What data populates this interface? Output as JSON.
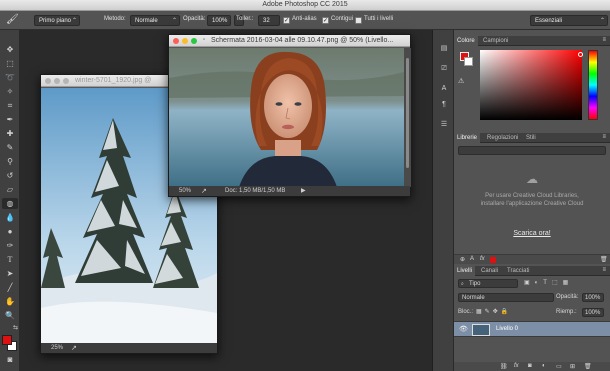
{
  "app": {
    "title": "Adobe Photoshop CC 2015"
  },
  "options_bar": {
    "tool_preset_icon": "brush-icon",
    "preset_dropdown": "Primo piano",
    "method_label": "Metodo:",
    "method_value": "Normale",
    "opacity_label": "Opacità:",
    "opacity_value": "100%",
    "tolerance_label": "Toller.:",
    "tolerance_value": "32",
    "antialias_label": "Anti-alias",
    "contiguous_label": "Contigui",
    "all_layers_label": "Tutti i livelli",
    "workspace_value": "Essenziali"
  },
  "doc_front": {
    "title": "Schermata 2016-03-04 alle 09.10.47.png @ 50% (Livello...",
    "zoom": "50%",
    "doc_info": "Doc: 1,50 MB/1,50 MB"
  },
  "doc_back": {
    "title": "winter-5701_1920.jpg @",
    "zoom": "25%"
  },
  "color_panel": {
    "tabs": [
      "Colore",
      "Campioni"
    ],
    "accent": "#e01010"
  },
  "library_panel": {
    "tabs": [
      "Librerie",
      "Regolazioni",
      "Stili"
    ],
    "message": "Per usare Creative Cloud Libraries, installare l'applicazione Creative Cloud",
    "link": "Scarica ora!"
  },
  "layers_panel": {
    "tabs": [
      "Livelli",
      "Canali",
      "Tracciati"
    ],
    "kind_filter": "Tipo",
    "blend_mode": "Normale",
    "opacity_label": "Opacità:",
    "opacity_value": "100%",
    "lock_label": "Bloc.:",
    "fill_label": "Riemp.:",
    "fill_value": "100%",
    "layers": [
      {
        "name": "Livello 0",
        "visible": true,
        "selected": true
      }
    ]
  }
}
